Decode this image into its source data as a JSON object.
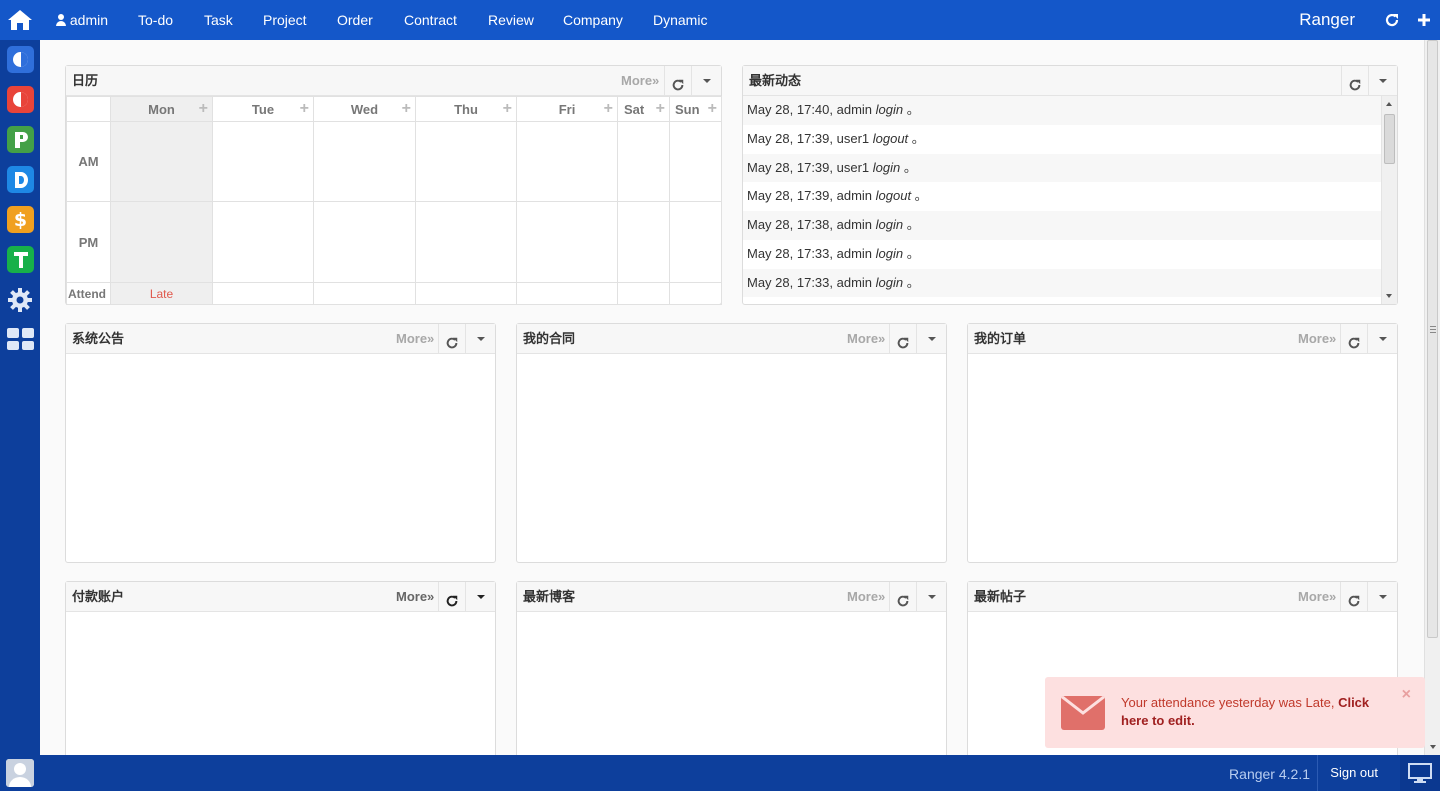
{
  "topnav": {
    "user": "admin",
    "items": [
      "To-do",
      "Task",
      "Project",
      "Order",
      "Contract",
      "Review",
      "Company",
      "Dynamic"
    ],
    "brand": "Ranger"
  },
  "leftbar": {
    "apps": [
      {
        "name": "C",
        "color": "#2f6fdb"
      },
      {
        "name": "O",
        "color": "#e8443a"
      },
      {
        "name": "P",
        "color": "#43a047"
      },
      {
        "name": "D",
        "color": "#1e88e5"
      },
      {
        "name": "S",
        "color": "#f0a020"
      },
      {
        "name": "T",
        "color": "#17b04a"
      }
    ]
  },
  "calendar": {
    "title": "日历",
    "more": "More»",
    "days": [
      "Mon",
      "Tue",
      "Wed",
      "Thu",
      "Fri",
      "Sat",
      "Sun"
    ],
    "rows": [
      "AM",
      "PM",
      "Attend"
    ],
    "attend_mon": "Late"
  },
  "dynamic": {
    "title": "最新动态",
    "entries": [
      {
        "text": "May 28, 17:40, admin ",
        "action": "login",
        "end": " 。"
      },
      {
        "text": "May 28, 17:39, user1 ",
        "action": "logout",
        "end": " 。"
      },
      {
        "text": "May 28, 17:39, user1 ",
        "action": "login",
        "end": " 。"
      },
      {
        "text": "May 28, 17:39, admin ",
        "action": "logout",
        "end": " 。"
      },
      {
        "text": "May 28, 17:38, admin ",
        "action": "login",
        "end": " 。"
      },
      {
        "text": "May 28, 17:33, admin ",
        "action": "login",
        "end": " 。"
      },
      {
        "text": "May 28, 17:33, admin ",
        "action": "login",
        "end": " 。"
      }
    ]
  },
  "blocks": {
    "notice": {
      "title": "系统公告",
      "more": "More»"
    },
    "contract": {
      "title": "我的合同",
      "more": "More»"
    },
    "order": {
      "title": "我的订单",
      "more": "More»"
    },
    "account": {
      "title": "付款账户",
      "more": "More»"
    },
    "blog": {
      "title": "最新博客",
      "more": "More»"
    },
    "thread": {
      "title": "最新帖子",
      "more": "More»"
    }
  },
  "statusbar": {
    "version": "Ranger 4.2.1",
    "signout": "Sign out"
  },
  "toast": {
    "message": "Your attendance yesterday was Late, ",
    "link": "Click here to edit.",
    "close": "×"
  }
}
